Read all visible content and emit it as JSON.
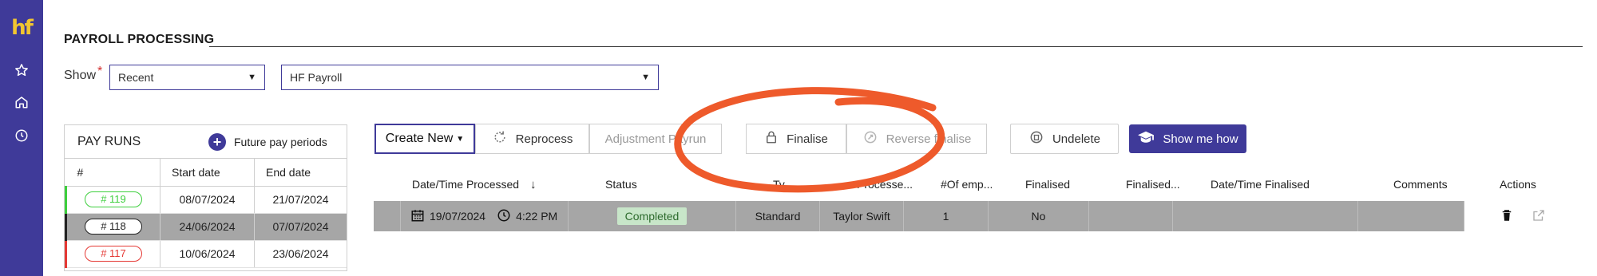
{
  "sidebar": {
    "logo": "hf",
    "icons": [
      "star-icon",
      "home-icon",
      "clock-icon"
    ]
  },
  "page": {
    "title": "PAYROLL PROCESSING"
  },
  "filters": {
    "show_label": "Show",
    "required_mark": "*",
    "period": "Recent",
    "payroll": "HF Payroll"
  },
  "pay_runs": {
    "title": "PAY RUNS",
    "future_label": "Future pay periods",
    "columns": [
      "#",
      "Start date",
      "End date"
    ],
    "rows": [
      {
        "id": "# 119",
        "start": "08/07/2024",
        "end": "21/07/2024",
        "color": "#3ecf3e"
      },
      {
        "id": "# 118",
        "start": "24/06/2024",
        "end": "07/07/2024",
        "color": "#222222"
      },
      {
        "id": "# 117",
        "start": "10/06/2024",
        "end": "23/06/2024",
        "color": "#e53935"
      }
    ]
  },
  "toolbar": {
    "create_new": "Create New",
    "reprocess": "Reprocess",
    "adjustment": "Adjustment Payrun",
    "finalise": "Finalise",
    "reverse_finalise": "Reverse finalise",
    "undelete": "Undelete",
    "show_me_how": "Show me how"
  },
  "grid": {
    "columns": {
      "processed": "Date/Time Processed",
      "status": "Status",
      "type": "Ty",
      "processed_by": "Processe...",
      "employees": "#Of emp...",
      "finalised": "Finalised",
      "finalised_by": "Finalised...",
      "finalised_time": "Date/Time Finalised",
      "comments": "Comments",
      "actions": "Actions"
    },
    "row": {
      "date": "19/07/2024",
      "time": "4:22 PM",
      "status": "Completed",
      "type": "Standard",
      "processed_by": "Taylor Swift",
      "employees": "1",
      "finalised": "No",
      "finalised_by": "",
      "finalised_time": "",
      "comments": ""
    }
  },
  "colors": {
    "brand": "#3f3a99",
    "accent_logo": "#f2c530",
    "annotation": "#ee5a2b",
    "status_completed_bg": "#c8e6c9"
  }
}
